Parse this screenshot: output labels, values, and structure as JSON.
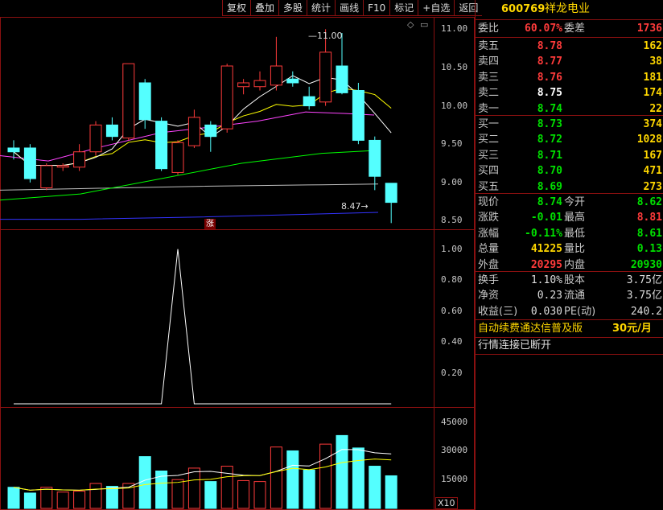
{
  "toolbar": [
    "复权",
    "叠加",
    "多股",
    "统计",
    "画线",
    "F10",
    "标记",
    "+自选",
    "返回"
  ],
  "stock": {
    "code": "600769",
    "name": "祥龙电业"
  },
  "weibi": {
    "label": "委比",
    "value": "60.07%",
    "label2": "委差",
    "value2": "1736"
  },
  "asks": [
    {
      "label": "卖五",
      "price": "8.78",
      "vol": "162",
      "color": "red"
    },
    {
      "label": "卖四",
      "price": "8.77",
      "vol": "38",
      "color": "red"
    },
    {
      "label": "卖三",
      "price": "8.76",
      "vol": "181",
      "color": "red"
    },
    {
      "label": "卖二",
      "price": "8.75",
      "vol": "174",
      "color": "white"
    },
    {
      "label": "卖一",
      "price": "8.74",
      "vol": "22",
      "color": "green"
    }
  ],
  "bids": [
    {
      "label": "买一",
      "price": "8.73",
      "vol": "374",
      "color": "green"
    },
    {
      "label": "买二",
      "price": "8.72",
      "vol": "1028",
      "color": "green"
    },
    {
      "label": "买三",
      "price": "8.71",
      "vol": "167",
      "color": "green"
    },
    {
      "label": "买四",
      "price": "8.70",
      "vol": "471",
      "color": "green"
    },
    {
      "label": "买五",
      "price": "8.69",
      "vol": "273",
      "color": "green"
    }
  ],
  "quote": [
    {
      "l1": "现价",
      "v1": "8.74",
      "c1": "green",
      "l2": "今开",
      "v2": "8.62",
      "c2": "green"
    },
    {
      "l1": "涨跌",
      "v1": "-0.01",
      "c1": "green",
      "l2": "最高",
      "v2": "8.81",
      "c2": "red"
    },
    {
      "l1": "涨幅",
      "v1": "-0.11%",
      "c1": "green",
      "l2": "最低",
      "v2": "8.61",
      "c2": "green"
    },
    {
      "l1": "总量",
      "v1": "41225",
      "c1": "yellow",
      "l2": "量比",
      "v2": "0.13",
      "c2": "green"
    },
    {
      "l1": "外盘",
      "v1": "20295",
      "c1": "red",
      "l2": "内盘",
      "v2": "20930",
      "c2": "green"
    }
  ],
  "fundamentals": [
    {
      "l1": "换手",
      "v1": "1.10%",
      "l2": "股本",
      "v2": "3.75亿"
    },
    {
      "l1": "净资",
      "v1": "0.23",
      "l2": "流通",
      "v2": "3.75亿"
    },
    {
      "l1": "收益(三)",
      "v1": "0.030",
      "l2": "PE(动)",
      "v2": "240.2"
    }
  ],
  "ad": {
    "text": "自动续费通达信普及版",
    "price": "30元/月"
  },
  "status": "行情连接已断开",
  "main_chart": {
    "yticks": [
      "11.00",
      "10.50",
      "10.00",
      "9.50",
      "9.00",
      "8.50"
    ],
    "high_label": "11.00",
    "low_label": "8.47",
    "zhang_label": "涨"
  },
  "indicator": {
    "yticks": [
      "1.00",
      "0.80",
      "0.60",
      "0.40",
      "0.20"
    ]
  },
  "volume": {
    "yticks": [
      "45000",
      "30000",
      "15000"
    ],
    "unit": "X10"
  },
  "colors": {
    "up": "#ff3b3b",
    "down": "#54ffff",
    "ma5": "#ffffff",
    "ma10": "#ffff00",
    "ma20": "#ff44ff",
    "ma60": "#00ff00",
    "ma120": "#c0c0c0",
    "ma250": "#3333ff",
    "frame": "#8a1010"
  },
  "chart_data": {
    "type": "candlestick",
    "candles": [
      {
        "o": 9.45,
        "c": 9.4,
        "h": 9.55,
        "l": 9.3
      },
      {
        "o": 9.45,
        "c": 9.05,
        "h": 9.5,
        "l": 9.0
      },
      {
        "o": 8.93,
        "c": 9.22,
        "h": 9.25,
        "l": 8.9
      },
      {
        "o": 9.2,
        "c": 9.22,
        "h": 9.25,
        "l": 9.15
      },
      {
        "o": 9.2,
        "c": 9.4,
        "h": 9.5,
        "l": 9.15
      },
      {
        "o": 9.4,
        "c": 9.75,
        "h": 9.8,
        "l": 9.35
      },
      {
        "o": 9.75,
        "c": 9.6,
        "h": 9.85,
        "l": 9.55
      },
      {
        "o": 9.58,
        "c": 10.55,
        "h": 10.55,
        "l": 9.55
      },
      {
        "o": 10.3,
        "c": 9.82,
        "h": 10.35,
        "l": 9.7
      },
      {
        "o": 9.8,
        "c": 9.18,
        "h": 9.85,
        "l": 9.15
      },
      {
        "o": 9.13,
        "c": 9.52,
        "h": 9.55,
        "l": 9.1
      },
      {
        "o": 9.48,
        "c": 9.85,
        "h": 9.95,
        "l": 9.45
      },
      {
        "o": 9.75,
        "c": 9.6,
        "h": 9.8,
        "l": 9.4
      },
      {
        "o": 9.7,
        "c": 10.52,
        "h": 10.55,
        "l": 9.65
      },
      {
        "o": 10.25,
        "c": 10.3,
        "h": 10.35,
        "l": 10.15
      },
      {
        "o": 10.25,
        "c": 10.33,
        "h": 10.45,
        "l": 10.2
      },
      {
        "o": 10.27,
        "c": 10.52,
        "h": 10.9,
        "l": 10.2
      },
      {
        "o": 10.35,
        "c": 10.3,
        "h": 10.45,
        "l": 10.25
      },
      {
        "o": 10.12,
        "c": 10.0,
        "h": 10.25,
        "l": 9.95
      },
      {
        "o": 10.05,
        "c": 10.7,
        "h": 11.0,
        "l": 10.0
      },
      {
        "o": 10.52,
        "c": 10.17,
        "h": 10.95,
        "l": 10.15
      },
      {
        "o": 10.2,
        "c": 9.55,
        "h": 10.3,
        "l": 9.5
      },
      {
        "o": 9.55,
        "c": 9.08,
        "h": 9.6,
        "l": 8.9
      },
      {
        "o": 8.99,
        "c": 8.74,
        "h": 8.81,
        "l": 8.47
      }
    ],
    "indicator_values": [
      0,
      0,
      0,
      0,
      0,
      0,
      0,
      0,
      0,
      0,
      1,
      0,
      0,
      0,
      0,
      0,
      0,
      0,
      0,
      0,
      0,
      0,
      0,
      0
    ],
    "volumes": [
      11000,
      8000,
      11000,
      8500,
      9000,
      13000,
      11500,
      13000,
      27000,
      19500,
      15000,
      21000,
      14000,
      22000,
      14500,
      14000,
      32000,
      30000,
      20000,
      33500,
      38000,
      31500,
      22000,
      17000
    ],
    "ylim_price": [
      8.4,
      11.15
    ],
    "ylim_volume": [
      0,
      52000
    ],
    "ylim_indicator": [
      0,
      1.05
    ]
  }
}
